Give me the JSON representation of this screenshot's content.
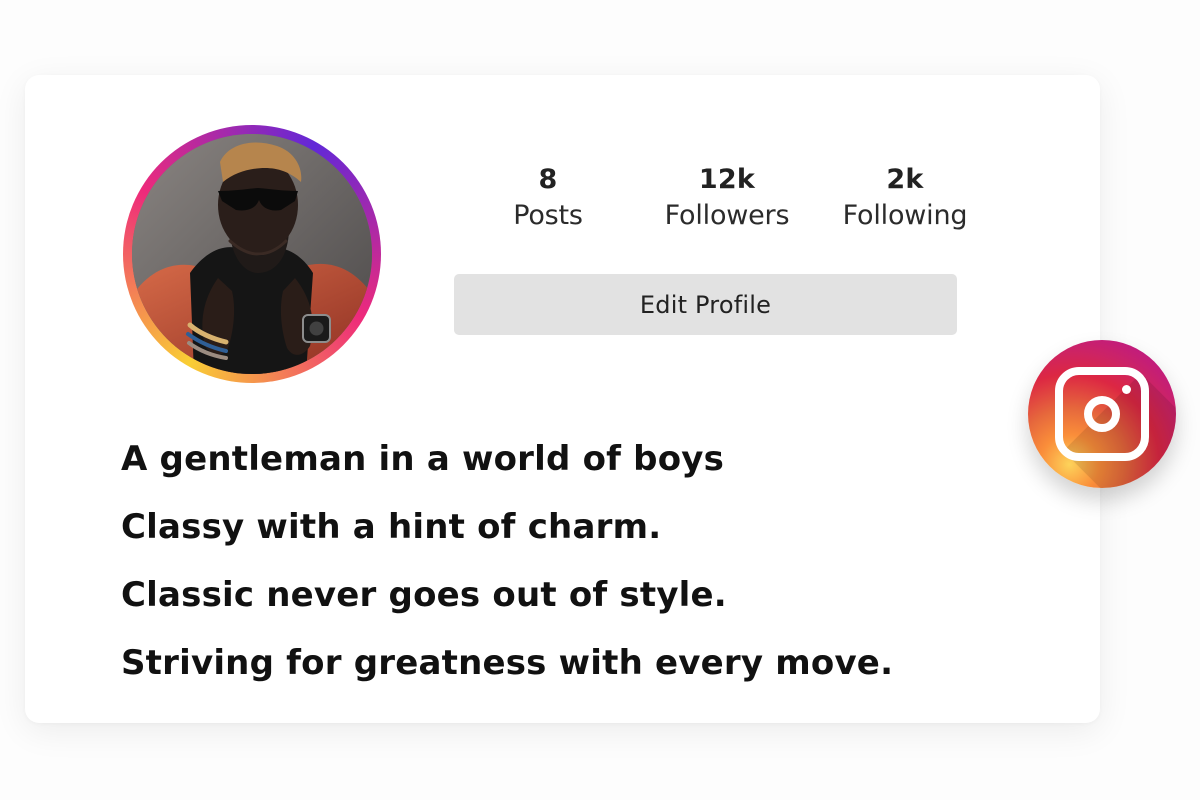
{
  "profile": {
    "stats": {
      "posts": {
        "value": "8",
        "label": "Posts"
      },
      "followers": {
        "value": "12k",
        "label": "Followers"
      },
      "following": {
        "value": "2k",
        "label": "Following"
      }
    },
    "edit_button_label": "Edit Profile",
    "avatar_icon": "profile-photo",
    "bio": [
      "A gentleman in a world of boys",
      "Classy with a hint of charm.",
      "Classic never goes out of style.",
      "Striving for greatness with every move."
    ]
  },
  "badge": {
    "icon": "instagram-icon"
  },
  "colors": {
    "ring_gradient": [
      "#f9ce34",
      "#ee2a7b",
      "#6228d7"
    ],
    "button_background": "#e2e2e2",
    "text": "#111111"
  }
}
